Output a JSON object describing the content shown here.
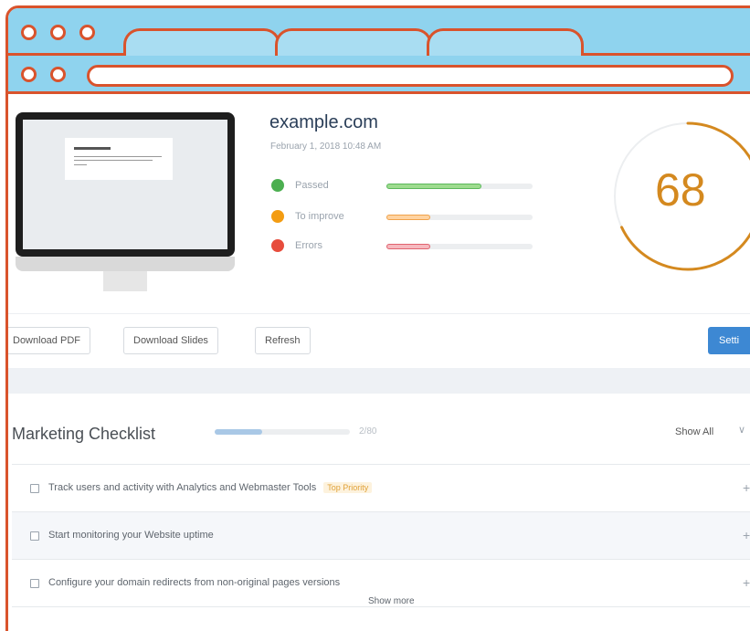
{
  "browser": {
    "tabs": [
      "",
      "",
      ""
    ],
    "url": ""
  },
  "site": {
    "title": "example.com",
    "date": "February 1, 2018 10:48 AM",
    "score": "68",
    "score_fraction": 0.68
  },
  "stats": [
    {
      "label": "Passed",
      "color": "#4caf50",
      "fill": "#9edc8f",
      "border": "#5cb85c",
      "fraction": 0.65
    },
    {
      "label": "To improve",
      "color": "#f39c12",
      "fill": "#ffd3a1",
      "border": "#f0a24a",
      "fraction": 0.3
    },
    {
      "label": "Errors",
      "color": "#e74c3c",
      "fill": "#f6b9bf",
      "border": "#e0636f",
      "fraction": 0.3
    }
  ],
  "actions": {
    "download_pdf": "Download PDF",
    "download_slides": "Download Slides",
    "refresh": "Refresh",
    "primary": "Setti"
  },
  "checklist": {
    "title": "Marketing Checklist",
    "count": "2/80",
    "progress_fraction": 0.35,
    "show_all": "Show All",
    "chevron": "∨",
    "items": [
      {
        "text": "Track users and activity with Analytics and Webmaster Tools",
        "badge": "Top Priority"
      },
      {
        "text": "Start monitoring your Website uptime",
        "badge": ""
      },
      {
        "text": "Configure your domain redirects from non-original pages versions",
        "badge": ""
      }
    ],
    "plus": "+",
    "show_more": "Show more"
  },
  "colors": {
    "accent_orange": "#d9532c",
    "titlebar_blue": "#8fd3ee",
    "score_ring": "#d4891f",
    "primary_button": "#3d88d3"
  }
}
